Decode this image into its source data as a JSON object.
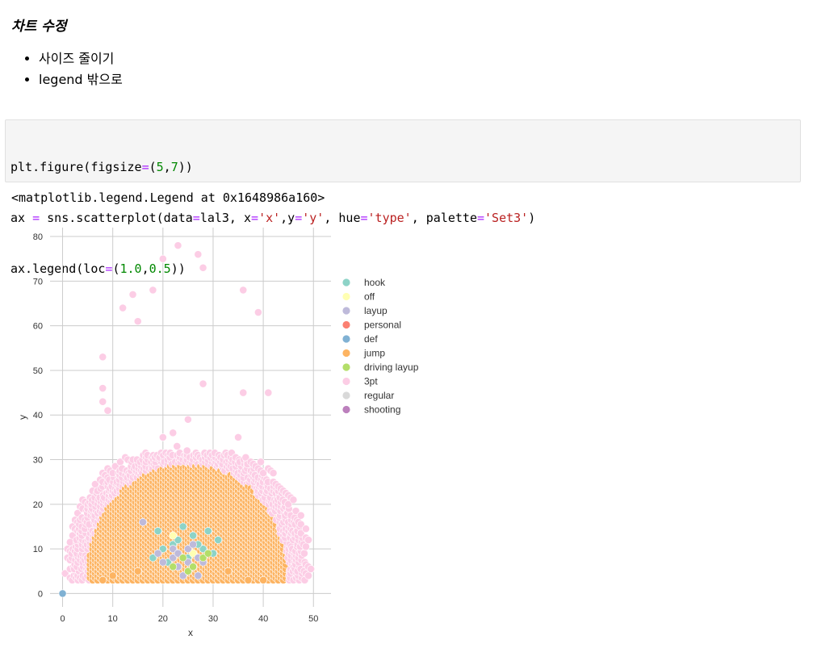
{
  "heading": "차트 수정",
  "bullets": [
    "사이즈 줄이기",
    "legend 밖으로"
  ],
  "code": {
    "line1": [
      [
        "plt.figure(figsize",
        ""
      ],
      [
        "=",
        "op"
      ],
      [
        "(",
        ""
      ],
      [
        "5",
        "num"
      ],
      [
        ",",
        ""
      ],
      [
        "7",
        "num"
      ],
      [
        "))",
        ""
      ]
    ],
    "line2": [
      [
        "ax ",
        ""
      ],
      [
        "=",
        "op"
      ],
      [
        " sns.scatterplot(data",
        ""
      ],
      [
        "=",
        "op"
      ],
      [
        "lal3, x",
        ""
      ],
      [
        "=",
        "op"
      ],
      [
        "'x'",
        "str"
      ],
      [
        ",y",
        ""
      ],
      [
        "=",
        "op"
      ],
      [
        "'y'",
        "str"
      ],
      [
        ", hue",
        ""
      ],
      [
        "=",
        "op"
      ],
      [
        "'type'",
        "str"
      ],
      [
        ", palette",
        ""
      ],
      [
        "=",
        "op"
      ],
      [
        "'Set3'",
        "str"
      ],
      [
        ")",
        ""
      ]
    ],
    "line3": [
      [
        "ax.legend(loc",
        ""
      ],
      [
        "=",
        "op"
      ],
      [
        "(",
        ""
      ],
      [
        "1.0",
        "num"
      ],
      [
        ",",
        ""
      ],
      [
        "0.5",
        "num"
      ],
      [
        "))",
        ""
      ]
    ]
  },
  "output_text": "<matplotlib.legend.Legend at 0x1648986a160>",
  "chart_data": {
    "type": "scatter",
    "xlabel": "x",
    "ylabel": "y",
    "xlim": [
      -2.5,
      53.5
    ],
    "ylim": [
      -3,
      82
    ],
    "xticks": [
      0,
      10,
      20,
      30,
      40,
      50
    ],
    "yticks": [
      0,
      10,
      20,
      30,
      40,
      50,
      60,
      70,
      80
    ],
    "grid": true,
    "legend_position": "outside-right",
    "series": [
      {
        "name": "hook",
        "color": "#8dd3c7",
        "points": [
          [
            18,
            8
          ],
          [
            20,
            10
          ],
          [
            22,
            11
          ],
          [
            23,
            12
          ],
          [
            25,
            8
          ],
          [
            26,
            13
          ],
          [
            28,
            10
          ],
          [
            30,
            9
          ],
          [
            31,
            12
          ],
          [
            19,
            14
          ],
          [
            24,
            15
          ],
          [
            27,
            11
          ],
          [
            21,
            7
          ],
          [
            29,
            14
          ]
        ]
      },
      {
        "name": "off",
        "color": "#ffffb3",
        "points": [
          [
            22,
            13
          ],
          [
            26,
            9
          ]
        ]
      },
      {
        "name": "layup",
        "color": "#bebada",
        "points": [
          [
            16,
            16
          ],
          [
            20,
            7
          ],
          [
            22,
            8
          ],
          [
            23,
            6
          ],
          [
            24,
            4
          ],
          [
            25,
            7
          ],
          [
            26,
            6
          ],
          [
            27,
            8
          ],
          [
            28,
            7
          ],
          [
            22,
            10
          ],
          [
            25,
            10
          ],
          [
            27,
            4
          ],
          [
            19,
            9
          ],
          [
            23,
            9
          ],
          [
            26,
            11
          ]
        ]
      },
      {
        "name": "personal",
        "color": "#fb8072",
        "points": []
      },
      {
        "name": "def",
        "color": "#80b1d3",
        "points": [
          [
            0,
            0
          ]
        ]
      },
      {
        "name": "jump",
        "color": "#fdb462",
        "points": []
      },
      {
        "name": "driving layup",
        "color": "#b3de69",
        "points": [
          [
            22,
            6
          ],
          [
            24,
            8
          ],
          [
            25,
            5
          ],
          [
            26,
            6
          ],
          [
            28,
            8
          ],
          [
            29,
            9
          ]
        ]
      },
      {
        "name": "3pt",
        "color": "#fccde5",
        "points": [
          [
            23,
            78
          ],
          [
            27,
            76
          ],
          [
            28,
            73
          ],
          [
            20,
            75
          ],
          [
            18,
            68
          ],
          [
            14,
            67
          ],
          [
            12,
            64
          ],
          [
            15,
            61
          ],
          [
            36,
            68
          ],
          [
            39,
            63
          ],
          [
            8,
            53
          ],
          [
            8,
            46
          ],
          [
            8,
            43
          ],
          [
            9,
            41
          ],
          [
            36,
            45
          ],
          [
            41,
            45
          ],
          [
            28,
            47
          ],
          [
            25,
            39
          ],
          [
            20,
            35
          ],
          [
            22,
            36
          ],
          [
            35,
            35
          ]
        ]
      },
      {
        "name": "regular",
        "color": "#d9d9d9",
        "points": []
      },
      {
        "name": "shooting",
        "color": "#bc80bd",
        "points": []
      }
    ]
  }
}
